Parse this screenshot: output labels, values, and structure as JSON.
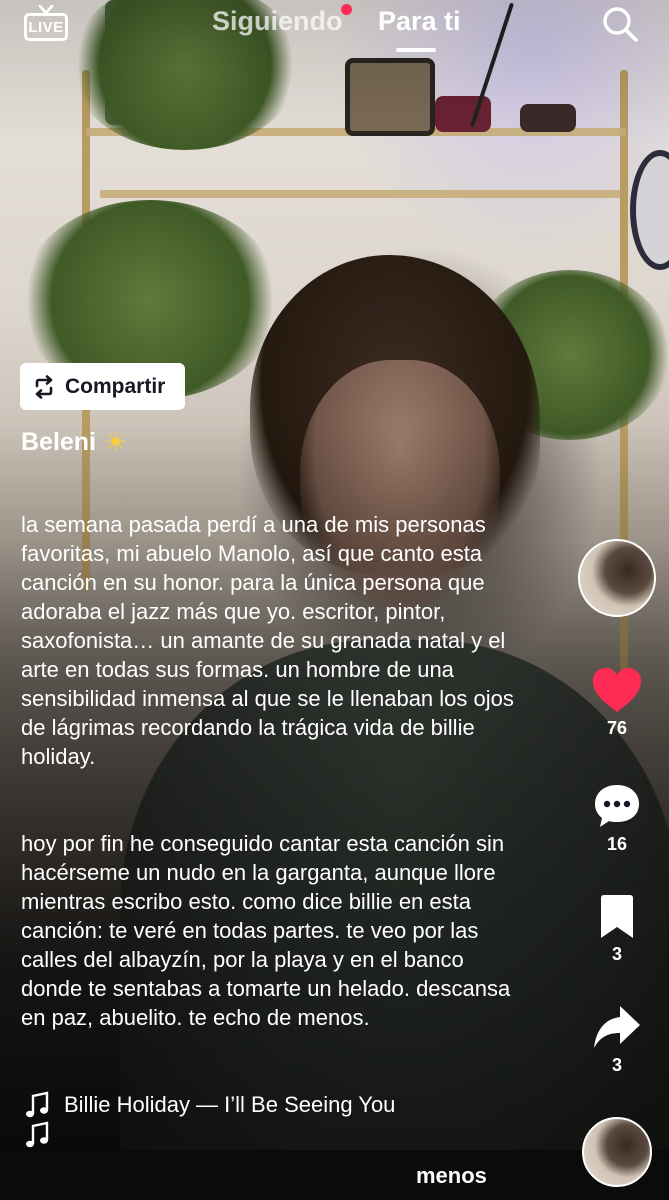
{
  "header": {
    "live_label": "LIVE",
    "tabs": [
      {
        "label": "Siguiendo"
      },
      {
        "label": "Para ti"
      }
    ],
    "notification_dot_color": "#fe2c55"
  },
  "share": {
    "label": "Compartir"
  },
  "post": {
    "author": "Beleni",
    "author_emoji": "☀",
    "caption_p1": "la semana pasada perdí a una de mis personas favoritas, mi abuelo Manolo, así que canto esta canción en su honor. para la única persona que adoraba el jazz más que yo. escritor, pintor, saxofonista… un amante de su granada natal y el arte en todas sus formas. un hombre de una sensibilidad inmensa al que se le llenaban los ojos de lágrimas recordando la trágica vida de billie holiday.",
    "caption_p2": "hoy por fin he conseguido cantar esta canción sin hacérseme un nudo en la garganta, aunque llore mientras escribo esto. como dice billie en esta canción: te veré en todas partes. te veo por las calles del albayzín, por la playa y en el banco donde te sentabas a tomarte un helado. descansa en paz, abuelito. te echo de menos.",
    "music": "Billie Holiday — I’ll Be Seeing You",
    "less_label": "menos"
  },
  "actions": {
    "likes": "76",
    "comments": "16",
    "saves": "3",
    "shares": "3",
    "like_color": "#fe2c55"
  },
  "icons": {
    "live": "live-tv-icon",
    "search": "search-icon",
    "share_chip": "repost-icon",
    "like": "heart-icon",
    "comment": "comment-bubble-icon",
    "save": "bookmark-icon",
    "share": "share-arrow-icon",
    "music": "music-note-icon"
  }
}
